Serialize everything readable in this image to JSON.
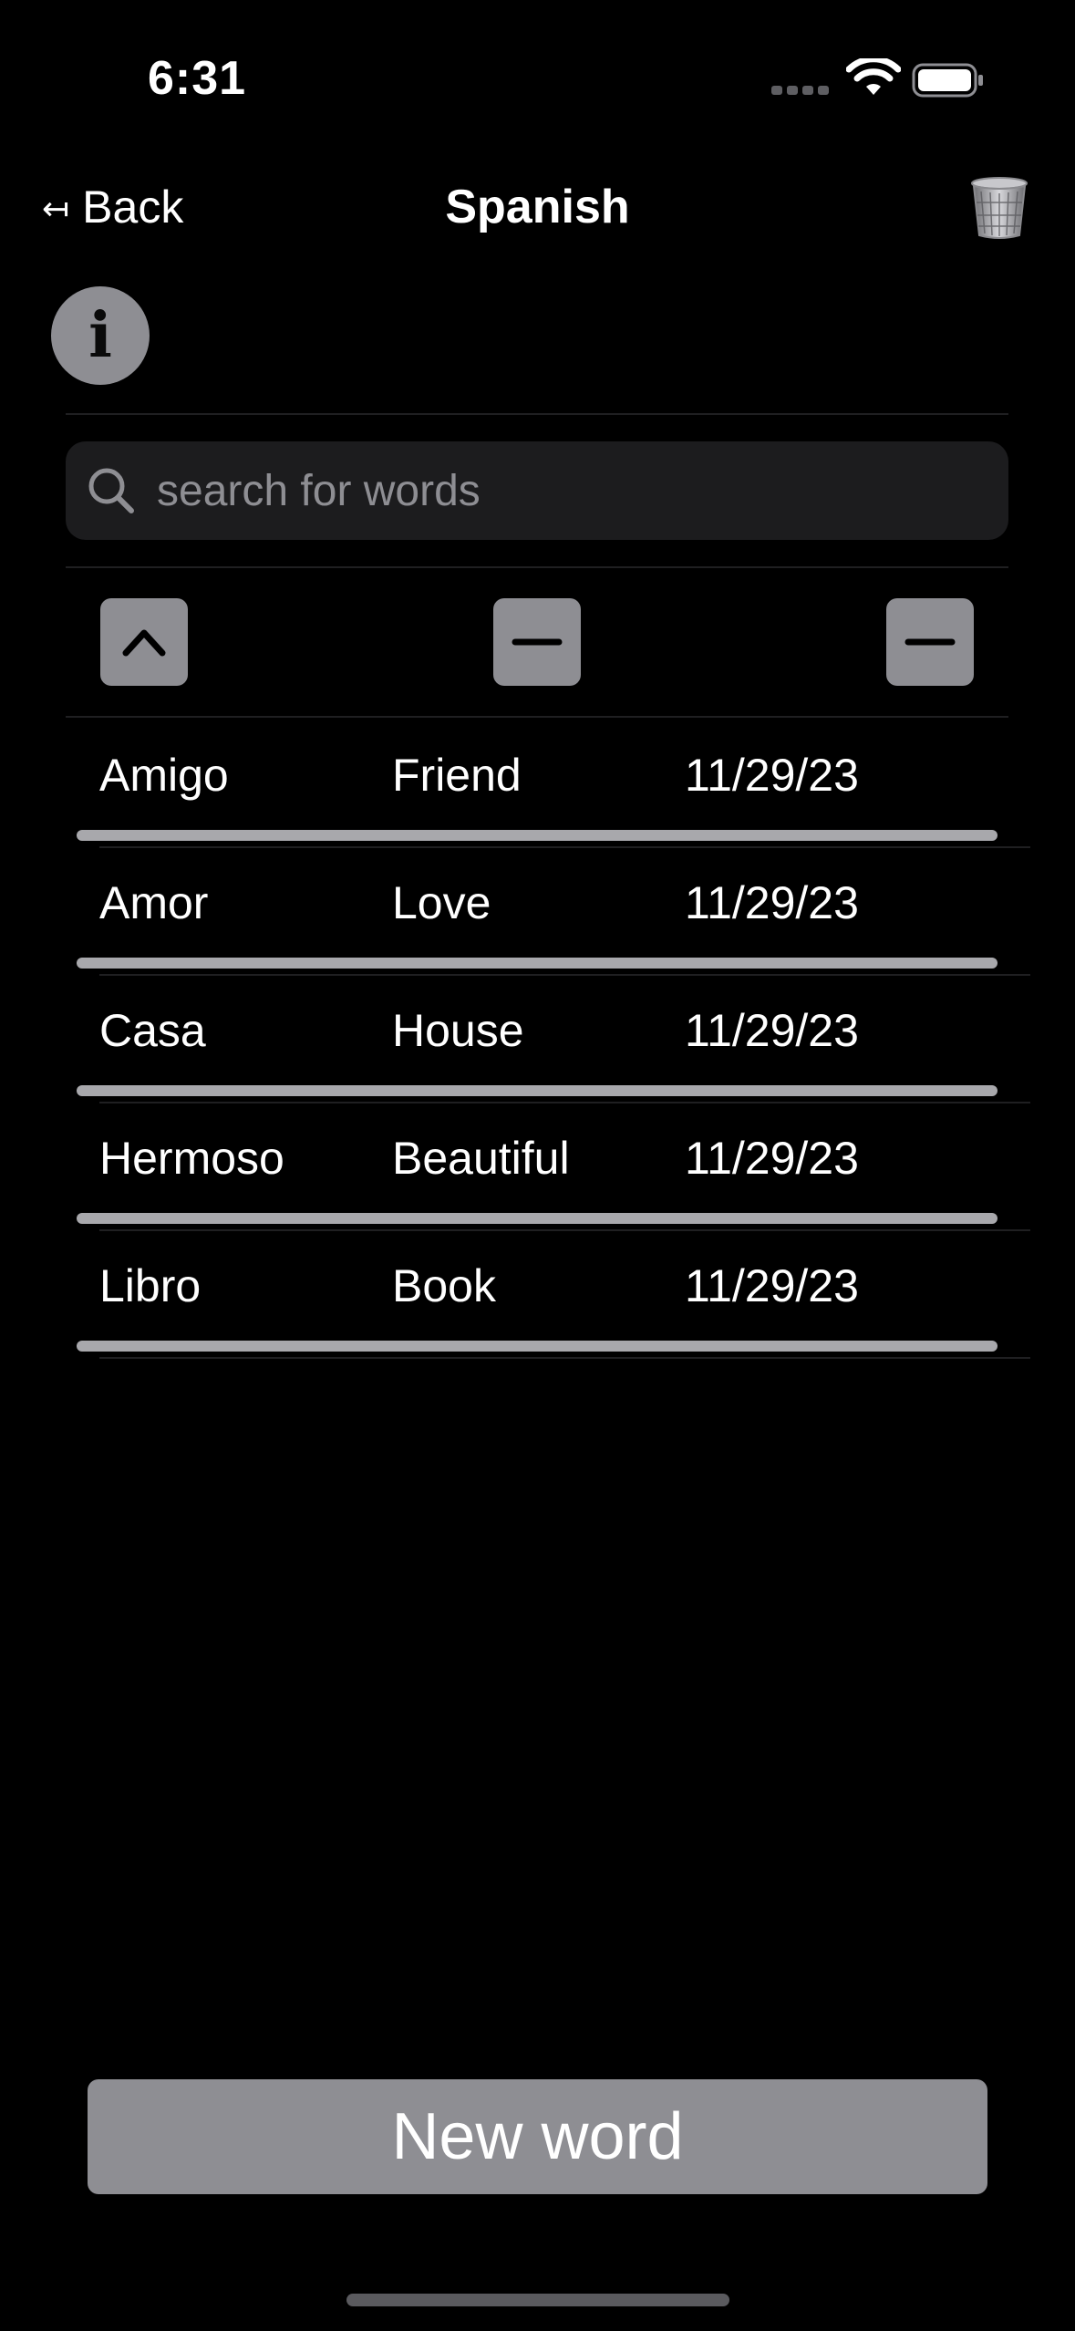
{
  "status_bar": {
    "time": "6:31"
  },
  "nav": {
    "back_label": "Back",
    "back_arrow": "↤",
    "title": "Spanish",
    "trash_icon": "trash-icon"
  },
  "info": {
    "glyph": "i"
  },
  "search": {
    "placeholder": "search for words",
    "value": ""
  },
  "sort_controls": {
    "word_sort": "chevron-up-icon",
    "translation_sort": "minus-icon",
    "date_sort": "minus-icon"
  },
  "words": [
    {
      "word": "Amigo",
      "translation": "Friend",
      "date": "11/29/23"
    },
    {
      "word": "Amor",
      "translation": "Love",
      "date": "11/29/23"
    },
    {
      "word": "Casa",
      "translation": "House",
      "date": "11/29/23"
    },
    {
      "word": "Hermoso",
      "translation": "Beautiful",
      "date": "11/29/23"
    },
    {
      "word": "Libro",
      "translation": "Book",
      "date": "11/29/23"
    }
  ],
  "actions": {
    "new_word_label": "New word"
  },
  "colors": {
    "background": "#000000",
    "control_gray": "#8e8e93",
    "search_field": "#1c1c1e",
    "progress_bar": "#a8a8ac"
  }
}
